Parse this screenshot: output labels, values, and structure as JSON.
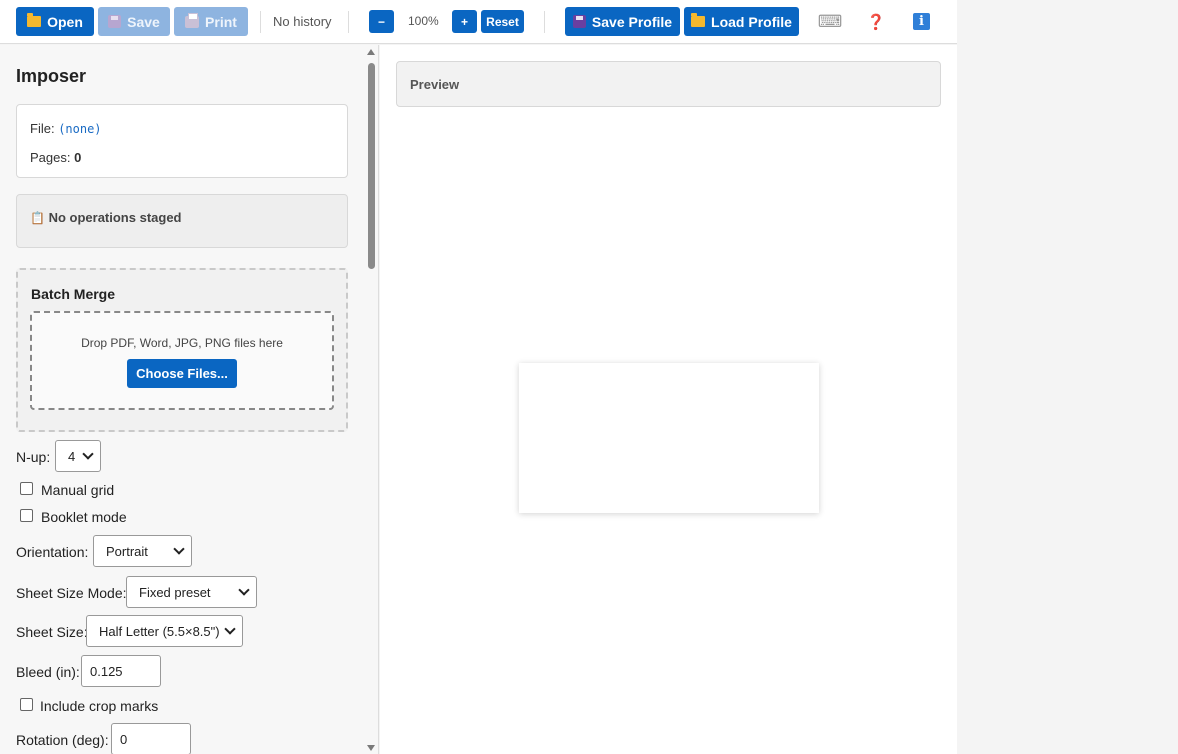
{
  "toolbar": {
    "open_label": "Open",
    "save_label": "Save",
    "print_label": "Print",
    "history_text": "No history",
    "zoom_out_label": "−",
    "zoom_level": "100%",
    "zoom_in_label": "+",
    "reset_label": "Reset",
    "save_profile_label": "Save Profile",
    "load_profile_label": "Load Profile",
    "keyboard_icon": "⌨",
    "help_icon": "❓",
    "info_icon": "i"
  },
  "sidebar": {
    "title": "Imposer",
    "file_label": "File:",
    "file_value": "(none)",
    "pages_label": "Pages:",
    "pages_value": "0",
    "staged_icon": "📋",
    "staged_text": "No operations staged",
    "batch_title": "Batch Merge",
    "drop_text": "Drop PDF, Word, JPG, PNG files here",
    "choose_files_label": "Choose Files...",
    "nup_label": "N-up:",
    "nup_value": "4",
    "manual_grid_label": "Manual grid",
    "booklet_mode_label": "Booklet mode",
    "orientation_label": "Orientation:",
    "orientation_value": "Portrait",
    "sheet_size_mode_label": "Sheet Size Mode:",
    "sheet_size_mode_value": "Fixed preset",
    "sheet_size_label": "Sheet Size:",
    "sheet_size_value": "Half Letter (5.5×8.5\")",
    "bleed_label": "Bleed (in):",
    "bleed_value": "0.125",
    "crop_marks_label": "Include crop marks",
    "rotation_label": "Rotation (deg):",
    "rotation_value": "0"
  },
  "main": {
    "preview_title": "Preview"
  },
  "colors": {
    "accent": "#0a66c2",
    "accent_disabled": "#8eb4e0",
    "link": "#1a6bc4"
  }
}
